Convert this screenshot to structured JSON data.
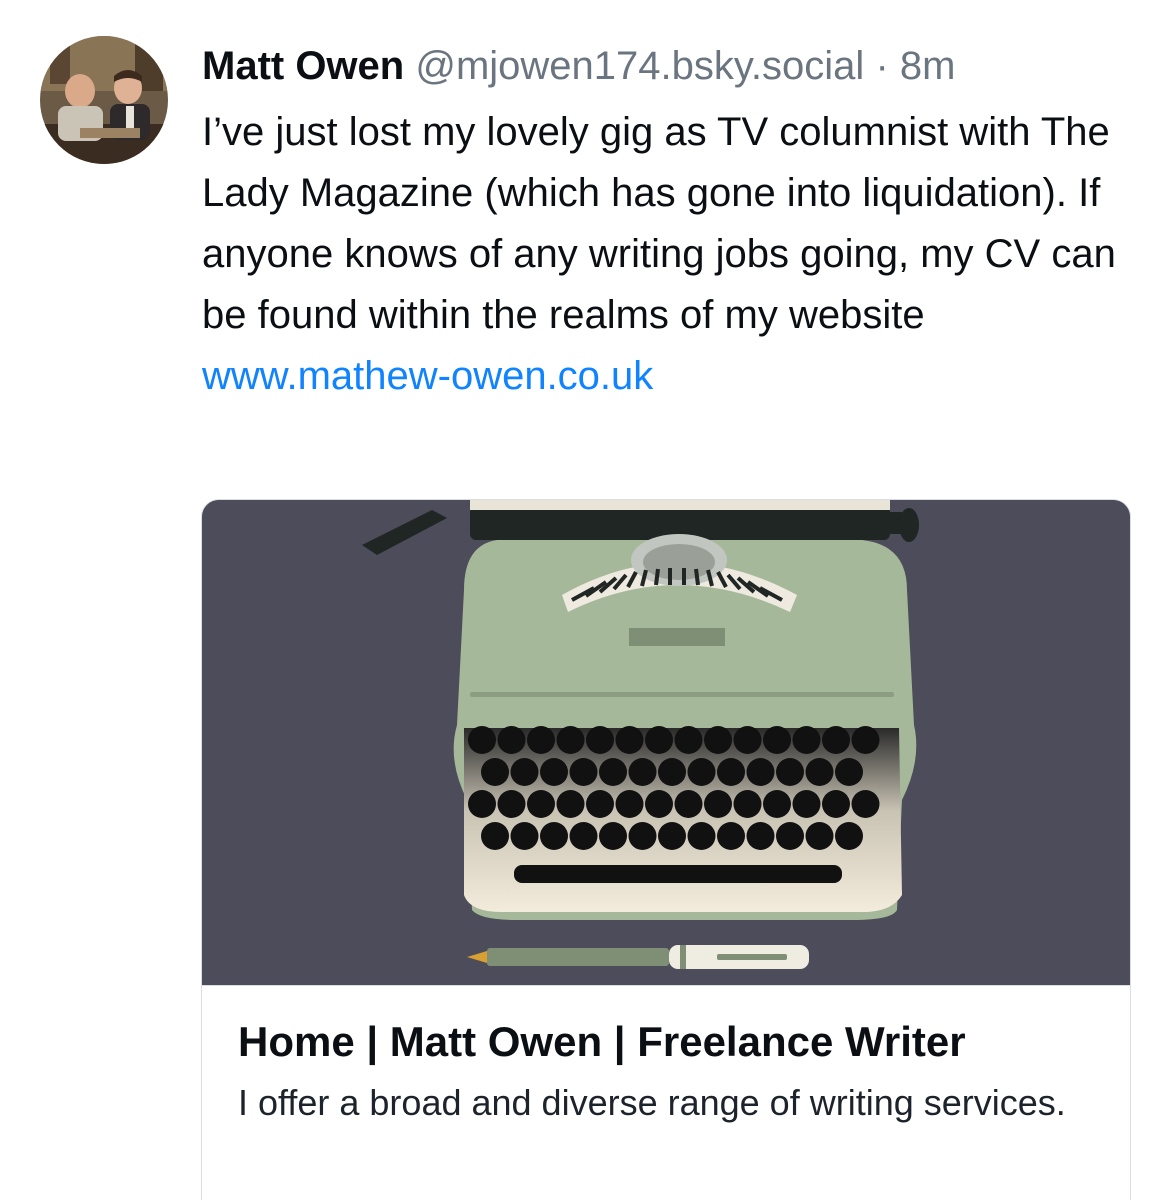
{
  "post": {
    "author_name": "Matt Owen",
    "handle": "@mjowen174.bsky.social",
    "separator": "·",
    "time_ago": "8m",
    "text": "I’ve just lost my lovely gig as TV columnist with The Lady Magazine (which has gone into liquidation). If anyone knows of any writing jobs going, my CV can be found within the realms of my website",
    "link_text": "www.mathew-owen.co.uk"
  },
  "link_card": {
    "image_icon": "typewriter-illustration",
    "title": "Home | Matt Owen | Freelance Writer",
    "description": "I offer a broad and diverse range of writing services."
  },
  "colors": {
    "link": "#1083fe",
    "card_image_bg": "#4d4c5a",
    "typewriter_body": "#a6b89a",
    "muted_text": "#6b7580"
  }
}
